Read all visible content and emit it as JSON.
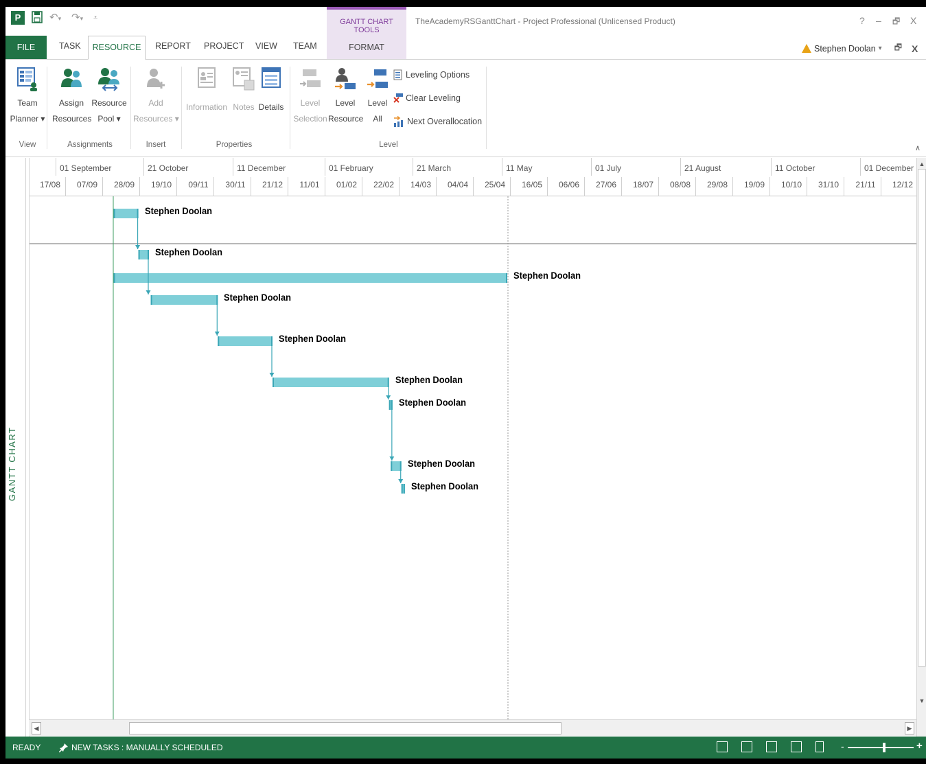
{
  "titlebar": {
    "context_tab_title": "GANTT CHART TOOLS",
    "document_title": "TheAcademyRSGanttChart - Project Professional (Unlicensed Product)",
    "help": "?",
    "minimize": "–",
    "restore": "🗗",
    "close": "X"
  },
  "tabs": {
    "file": "FILE",
    "task": "TASK",
    "resource": "RESOURCE",
    "report": "REPORT",
    "project": "PROJECT",
    "view": "VIEW",
    "team": "TEAM",
    "format": "FORMAT"
  },
  "user": {
    "name": "Stephen Doolan",
    "dropdown": "▾",
    "restore": "🗗",
    "close": "X"
  },
  "ribbon": {
    "team_planner": [
      "Team",
      "Planner ▾"
    ],
    "assign_resources": [
      "Assign",
      "Resources"
    ],
    "resource_pool": [
      "Resource",
      "Pool ▾"
    ],
    "add_resources": [
      "Add",
      "Resources ▾"
    ],
    "information": "Information",
    "notes": "Notes",
    "details": "Details",
    "level_selection": [
      "Level",
      "Selection"
    ],
    "level_resource": [
      "Level",
      "Resource"
    ],
    "level_all": [
      "Level",
      "All"
    ],
    "leveling_options": "Leveling Options",
    "clear_leveling": "Clear Leveling",
    "next_overallocation": "Next Overallocation",
    "groups": {
      "view": "View",
      "assignments": "Assignments",
      "insert": "Insert",
      "properties": "Properties",
      "level": "Level"
    },
    "collapse": "∧"
  },
  "view_bar_label": "GANTT CHART",
  "timescale": {
    "top": [
      "01 September",
      "21 October",
      "11 December",
      "01 February",
      "21 March",
      "11 May",
      "01 July",
      "21 August",
      "11 October",
      "01 December"
    ],
    "bottom": [
      "17/08",
      "07/09",
      "28/09",
      "19/10",
      "09/11",
      "30/11",
      "21/12",
      "11/01",
      "01/02",
      "22/02",
      "14/03",
      "04/04",
      "25/04",
      "16/05",
      "06/06",
      "27/06",
      "18/07",
      "08/08",
      "29/08",
      "19/09",
      "10/10",
      "31/10",
      "21/11",
      "12/12"
    ]
  },
  "tasks": [
    {
      "start": "22/09",
      "end": "06/10",
      "resource": "Stephen Doolan"
    },
    {
      "start": "06/10",
      "end": "12/10",
      "resource": "Stephen Doolan"
    },
    {
      "start": "22/09",
      "end": "03/05",
      "resource": "Stephen Doolan"
    },
    {
      "start": "13/10",
      "end": "20/11",
      "resource": "Stephen Doolan"
    },
    {
      "start": "20/11",
      "end": "21/12",
      "resource": "Stephen Doolan"
    },
    {
      "start": "21/12",
      "end": "25/02",
      "resource": "Stephen Doolan"
    },
    {
      "start": "25/02",
      "end": "27/02",
      "resource": "Stephen Doolan"
    },
    {
      "start": "26/02",
      "end": "04/03",
      "resource": "Stephen Doolan"
    },
    {
      "start": "04/03",
      "end": "06/03",
      "resource": "Stephen Doolan"
    }
  ],
  "colors": {
    "accent": "#217346",
    "bar": "#7fcfd8",
    "bar_edge": "#3aa6b6",
    "context": "#9c5bb7"
  },
  "statusbar": {
    "ready": "READY",
    "new_tasks": "NEW TASKS : MANUALLY SCHEDULED",
    "zoom_minus": "-",
    "zoom_plus": "+",
    "zoom_level": 0.55
  }
}
